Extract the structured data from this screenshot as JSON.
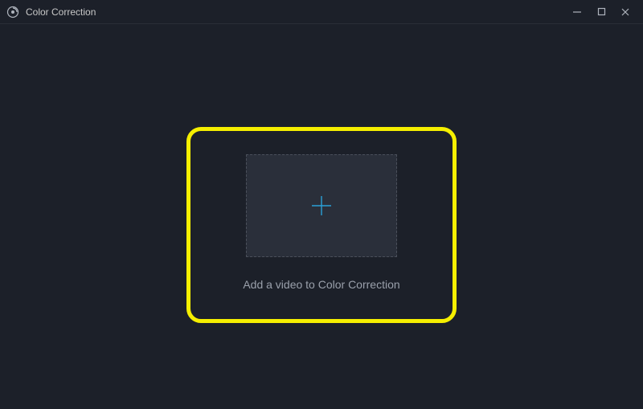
{
  "window": {
    "title": "Color Correction"
  },
  "main": {
    "instruction": "Add a video to Color Correction"
  },
  "icons": {
    "app": "color-correction-app-icon",
    "plus": "plus-icon",
    "minimize": "minimize-icon",
    "maximize": "maximize-icon",
    "close": "close-icon"
  },
  "colors": {
    "accent": "#2aa0d8",
    "highlight": "#f5ef00",
    "bg": "#1c2029"
  }
}
